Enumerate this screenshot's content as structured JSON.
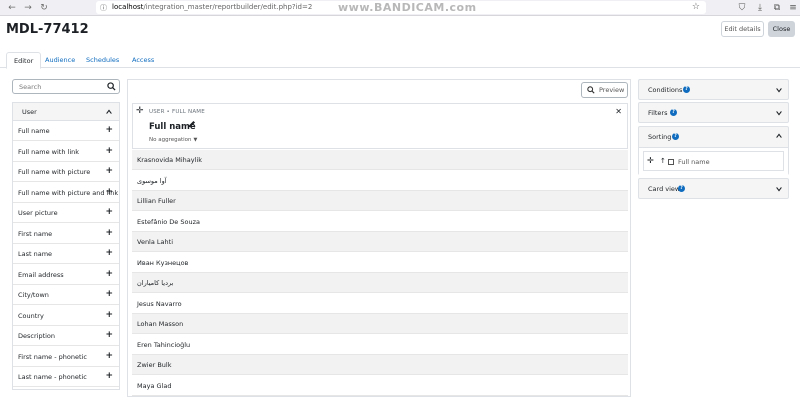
{
  "browser": {
    "url_host": "localhost",
    "url_path": "/integration_master/reportbuilder/edit.php?id=2",
    "watermark": "www.BANDICAM.com"
  },
  "header": {
    "title": "MDL-77412",
    "edit_details_label": "Edit details",
    "close_label": "Close"
  },
  "tabs": [
    {
      "label": "Editor",
      "active": true
    },
    {
      "label": "Audience",
      "active": false
    },
    {
      "label": "Schedules",
      "active": false
    },
    {
      "label": "Access",
      "active": false
    }
  ],
  "sidebar": {
    "search_placeholder": "Search",
    "section_label": "User",
    "items": [
      {
        "label": "Full name"
      },
      {
        "label": "Full name with link"
      },
      {
        "label": "Full name with picture"
      },
      {
        "label": "Full name with picture and link"
      },
      {
        "label": "User picture"
      },
      {
        "label": "First name"
      },
      {
        "label": "Last name"
      },
      {
        "label": "Email address"
      },
      {
        "label": "City/town"
      },
      {
        "label": "Country"
      },
      {
        "label": "Description"
      },
      {
        "label": "First name - phonetic"
      },
      {
        "label": "Last name - phonetic"
      }
    ]
  },
  "main": {
    "preview_label": "Preview",
    "column": {
      "crumb": "USER • FULL NAME",
      "title": "Full name",
      "aggregation": "No aggregation"
    },
    "rows": [
      "Krasnovida Mihaylik",
      "آوا موسوی",
      "Lillian Fuller",
      "Estefânio De Souza",
      "Venla Lahti",
      "Иван Кузнецов",
      "بردیا کامیاران",
      "Jesus Navarro",
      "Lohan Masson",
      "Eren Tahincioğlu",
      "Zwier Bulk",
      "Maya Glad"
    ]
  },
  "right": {
    "conditions_label": "Conditions",
    "filters_label": "Filters",
    "sorting_label": "Sorting",
    "sorting_dir": "↑",
    "sorting_item": "Full name",
    "card_view_label": "Card view"
  },
  "colors": {
    "link": "#0f6cbf",
    "border": "#dee2e6",
    "panel_bg": "#f5f5f5"
  }
}
